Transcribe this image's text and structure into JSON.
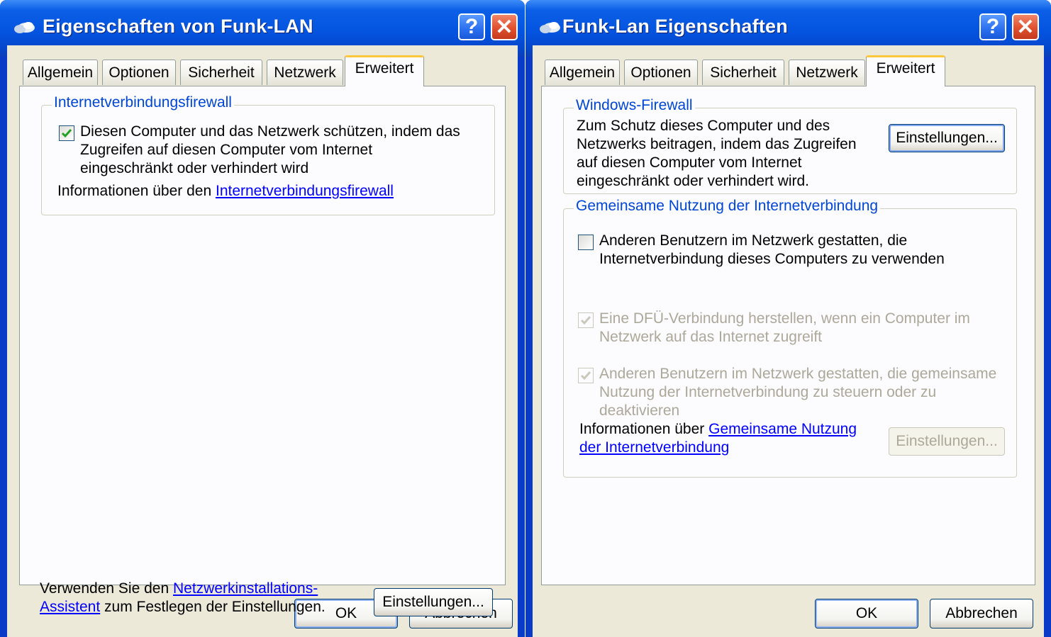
{
  "left": {
    "title": "Eigenschaften von Funk-LAN",
    "help_glyph": "?",
    "close_glyph": "✕",
    "tabs": [
      "Allgemein",
      "Optionen",
      "Sicherheit",
      "Netzwerk",
      "Erweitert"
    ],
    "active_tab": "Erweitert",
    "firewall_group": {
      "legend": "Internetverbindungsfirewall",
      "checkbox_checked": true,
      "checkbox_line1": "Diesen Computer und das Netzwerk schützen, indem das",
      "checkbox_line2": "Zugreifen auf diesen Computer vom Internet",
      "checkbox_line3": "eingeschränkt oder verhindert wird",
      "info_prefix": "Informationen über den ",
      "info_link": "Internetverbindungsfirewall"
    },
    "bottom": {
      "line1_prefix": "Verwenden Sie den ",
      "line1_link": "Netzwerkinstallations-",
      "line2_link": "Assistent",
      "line2_suffix": " zum Festlegen der Einstellungen.",
      "settings_button": "Einstellungen..."
    },
    "ok_button": "OK",
    "cancel_button": "Abbrechen"
  },
  "right": {
    "title": "Funk-Lan Eigenschaften",
    "help_glyph": "?",
    "close_glyph": "✕",
    "tabs": [
      "Allgemein",
      "Optionen",
      "Sicherheit",
      "Netzwerk",
      "Erweitert"
    ],
    "active_tab": "Erweitert",
    "firewall_group": {
      "legend": "Windows-Firewall",
      "line1": "Zum Schutz dieses Computer und des",
      "line2": "Netzwerks beitragen, indem das Zugreifen",
      "line3": "auf diesen Computer vom Internet",
      "line4": "eingeschränkt oder verhindert wird.",
      "settings_button": "Einstellungen..."
    },
    "ics_group": {
      "legend": "Gemeinsame Nutzung der Internetverbindung",
      "allow_checked": false,
      "allow_line1": "Anderen Benutzern im Netzwerk gestatten, die",
      "allow_line2": "Internetverbindung dieses Computers zu verwenden",
      "dialup_checked": true,
      "dialup_line1": "Eine DFÜ-Verbindung herstellen, wenn ein Computer im",
      "dialup_line2": "Netzwerk auf das Internet zugreift",
      "control_checked": true,
      "control_line1": "Anderen Benutzern im Netzwerk gestatten, die gemeinsame",
      "control_line2": "Nutzung der Internetverbindung zu steuern oder zu",
      "control_line3": "deaktivieren",
      "info_prefix": "Informationen über ",
      "info_link1": "Gemeinsame Nutzung",
      "info_link2": "der Internetverbindung",
      "settings_button": "Einstellungen..."
    },
    "ok_button": "OK",
    "cancel_button": "Abbrechen"
  },
  "colors": {
    "titlebar": "#0454e0",
    "dialog_bg": "#ece9d8",
    "panel_bg": "#fcfcfe",
    "group_legend": "#0046d5",
    "link": "#0000ff",
    "disabled_text": "#aca899",
    "active_tab_accent": "#ffc83c"
  }
}
